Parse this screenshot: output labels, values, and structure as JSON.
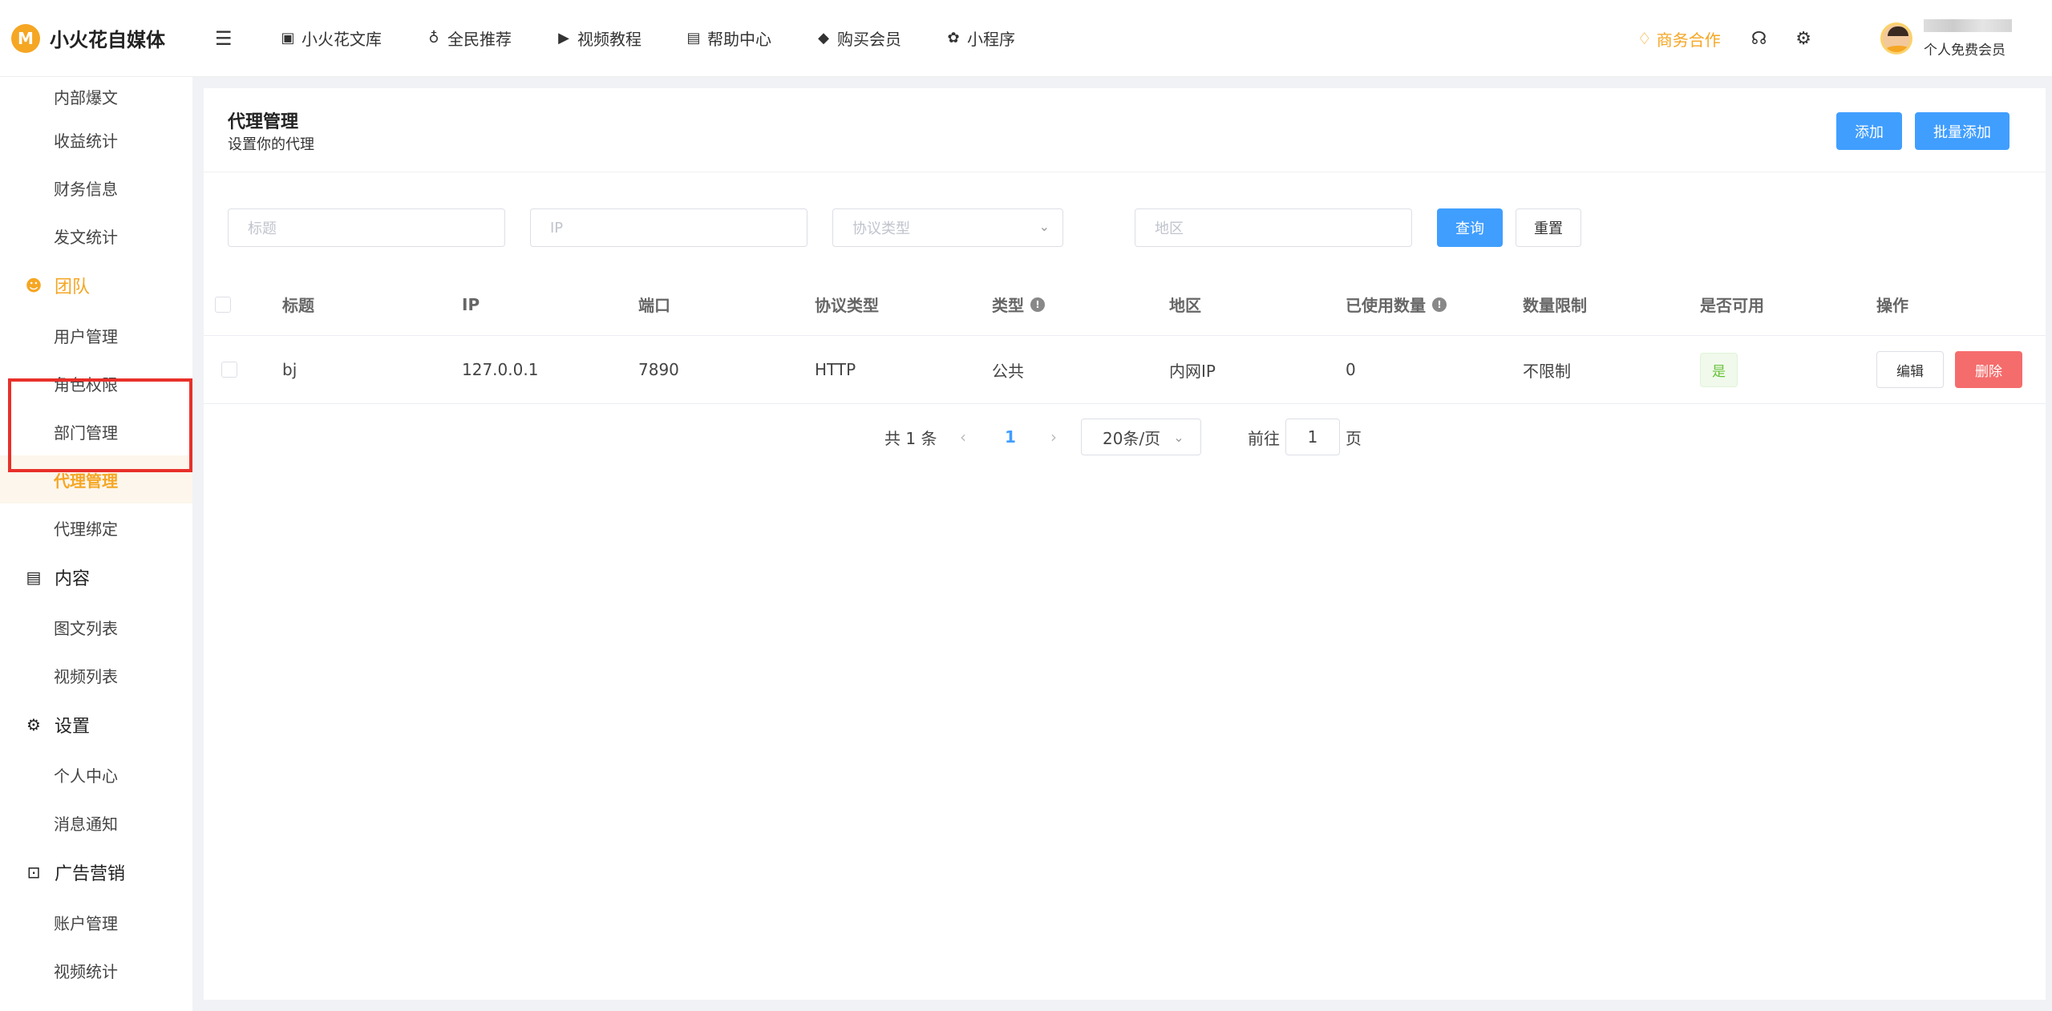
{
  "app": {
    "logo_mark": "M",
    "name": "小火花自媒体"
  },
  "topnav": [
    {
      "label": "小火花文库",
      "icon": "library-icon",
      "glyph": "▣"
    },
    {
      "label": "全民推荐",
      "icon": "money-bag-icon",
      "glyph": "♁"
    },
    {
      "label": "视频教程",
      "icon": "video-icon",
      "glyph": "▶"
    },
    {
      "label": "帮助中心",
      "icon": "book-icon",
      "glyph": "▤"
    },
    {
      "label": "购买会员",
      "icon": "diamond-icon",
      "glyph": "◆"
    },
    {
      "label": "小程序",
      "icon": "mini-program-icon",
      "glyph": "✿"
    }
  ],
  "header": {
    "business": "商务合作",
    "user_level": "个人免费会员",
    "accent": "#f5a623"
  },
  "sidebar": {
    "items_top": [
      "内部爆文",
      "收益统计",
      "财务信息",
      "发文统计"
    ],
    "team": {
      "label": "团队",
      "items": [
        "用户管理",
        "角色权限",
        "部门管理",
        "代理管理",
        "代理绑定"
      ]
    },
    "content": {
      "label": "内容",
      "items": [
        "图文列表",
        "视频列表"
      ]
    },
    "settings": {
      "label": "设置",
      "items": [
        "个人中心",
        "消息通知"
      ]
    },
    "ads": {
      "label": "广告营销",
      "items": [
        "账户管理",
        "视频统计"
      ]
    },
    "active": "代理管理"
  },
  "page": {
    "title": "代理管理",
    "subtitle": "设置你的代理",
    "add_label": "添加",
    "batch_add_label": "批量添加"
  },
  "filters": {
    "title_placeholder": "标题",
    "ip_placeholder": "IP",
    "protocol_placeholder": "协议类型",
    "region_placeholder": "地区",
    "query_label": "查询",
    "reset_label": "重置"
  },
  "table": {
    "headers": [
      "标题",
      "IP",
      "端口",
      "协议类型",
      "类型",
      "地区",
      "已使用数量",
      "数量限制",
      "是否可用",
      "操作"
    ],
    "rows": [
      {
        "title": "bj",
        "ip": "127.0.0.1",
        "port": "7890",
        "protocol": "HTTP",
        "type": "公共",
        "region": "内网IP",
        "used": "0",
        "limit": "不限制",
        "available": "是",
        "edit": "编辑",
        "delete": "删除"
      }
    ]
  },
  "pagination": {
    "total": "共 1 条",
    "current": "1",
    "page_size": "20条/页",
    "goto_prefix": "前往",
    "goto_value": "1",
    "goto_suffix": "页"
  }
}
